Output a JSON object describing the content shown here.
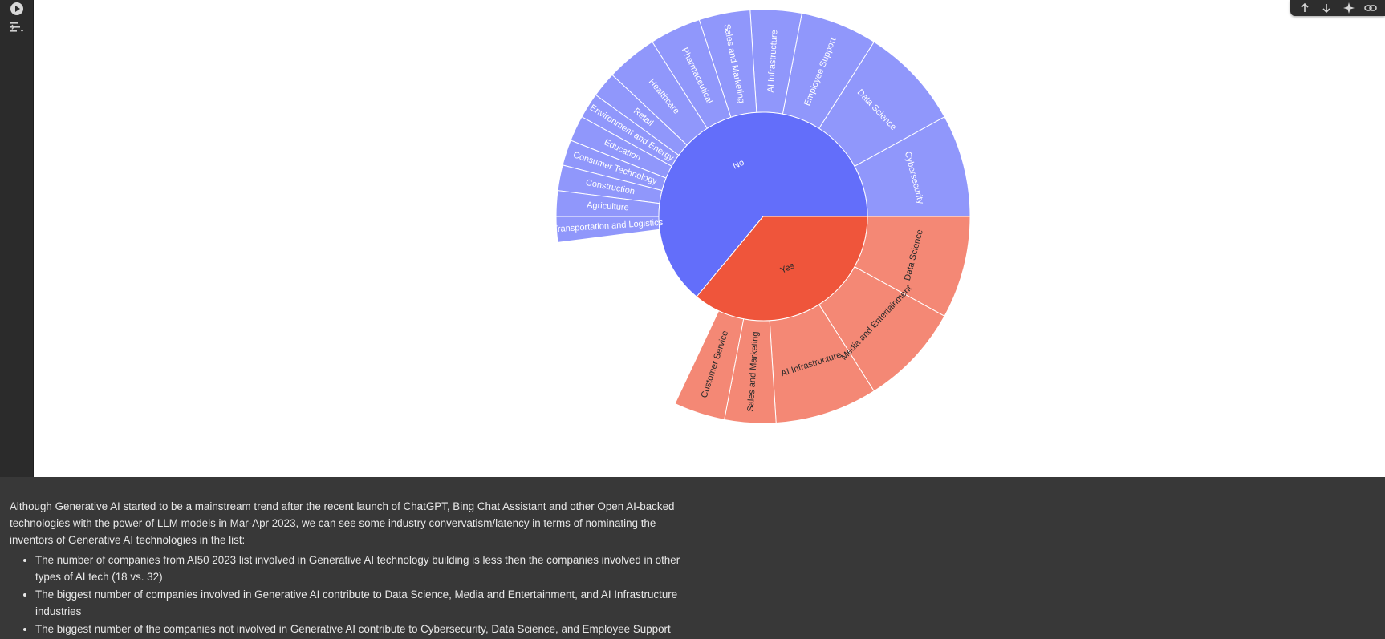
{
  "toolbar": {
    "icons": [
      "arrow-up-icon",
      "arrow-down-icon",
      "sparkle-icon",
      "link-icon"
    ]
  },
  "gutter": {
    "icons": [
      "play-icon",
      "output-options-icon"
    ]
  },
  "chart_data": {
    "type": "sunburst",
    "colors": {
      "No": "#636efa",
      "No_child": "#9097fb",
      "Yes": "#ef553b",
      "Yes_child": "#f48875"
    },
    "inner": [
      {
        "label": "No",
        "value": 32
      },
      {
        "label": "Yes",
        "value": 18
      }
    ],
    "outer": [
      {
        "parent": "No",
        "label": "Cybersecurity",
        "value": 4
      },
      {
        "parent": "No",
        "label": "Data Science",
        "value": 4
      },
      {
        "parent": "No",
        "label": "Employee Support",
        "value": 3
      },
      {
        "parent": "No",
        "label": "AI Infrastructure",
        "value": 2
      },
      {
        "parent": "No",
        "label": "Sales and Marketing",
        "value": 2
      },
      {
        "parent": "No",
        "label": "Pharmaceutical",
        "value": 2
      },
      {
        "parent": "No",
        "label": "Healthcare",
        "value": 2
      },
      {
        "parent": "No",
        "label": "Retail",
        "value": 1
      },
      {
        "parent": "No",
        "label": "Environment and Energy",
        "value": 1
      },
      {
        "parent": "No",
        "label": "Education",
        "value": 1
      },
      {
        "parent": "No",
        "label": "Consumer Technology",
        "value": 1
      },
      {
        "parent": "No",
        "label": "Construction",
        "value": 1
      },
      {
        "parent": "No",
        "label": "Agriculture",
        "value": 1
      },
      {
        "parent": "No",
        "label": "Transportation and Logistics",
        "value": 1
      },
      {
        "parent": "Yes",
        "label": "Data Science",
        "value": 4
      },
      {
        "parent": "Yes",
        "label": "Media and Entertainment",
        "value": 4
      },
      {
        "parent": "Yes",
        "label": "AI Infrastructure",
        "value": 4
      },
      {
        "parent": "Yes",
        "label": "Sales and Marketing",
        "value": 2
      },
      {
        "parent": "Yes",
        "label": "Customer Service",
        "value": 2
      }
    ]
  },
  "markdown": {
    "intro": "Although Generative AI started to be a mainstream trend after the recent launch of ChatGPT, Bing Chat Assistant and other Open AI-backed technologies with the power of LLM models in Mar-Apr 2023, we can see some industry convervatism/latency in terms of nominating the inventors of Generative AI technologies in the list:",
    "bullets": [
      "The number of companies from AI50 2023 list involved in Generative AI technology building is less then the companies involved in other types of AI tech (18 vs. 32)",
      "The biggest number of companies involved in Generative AI contribute to Data Science, Media and Entertainment, and AI Infrastructure industries",
      "The biggest number of the companies not involved in Generative AI contribute to Cybersecurity, Data Science, and Employee Support"
    ]
  }
}
